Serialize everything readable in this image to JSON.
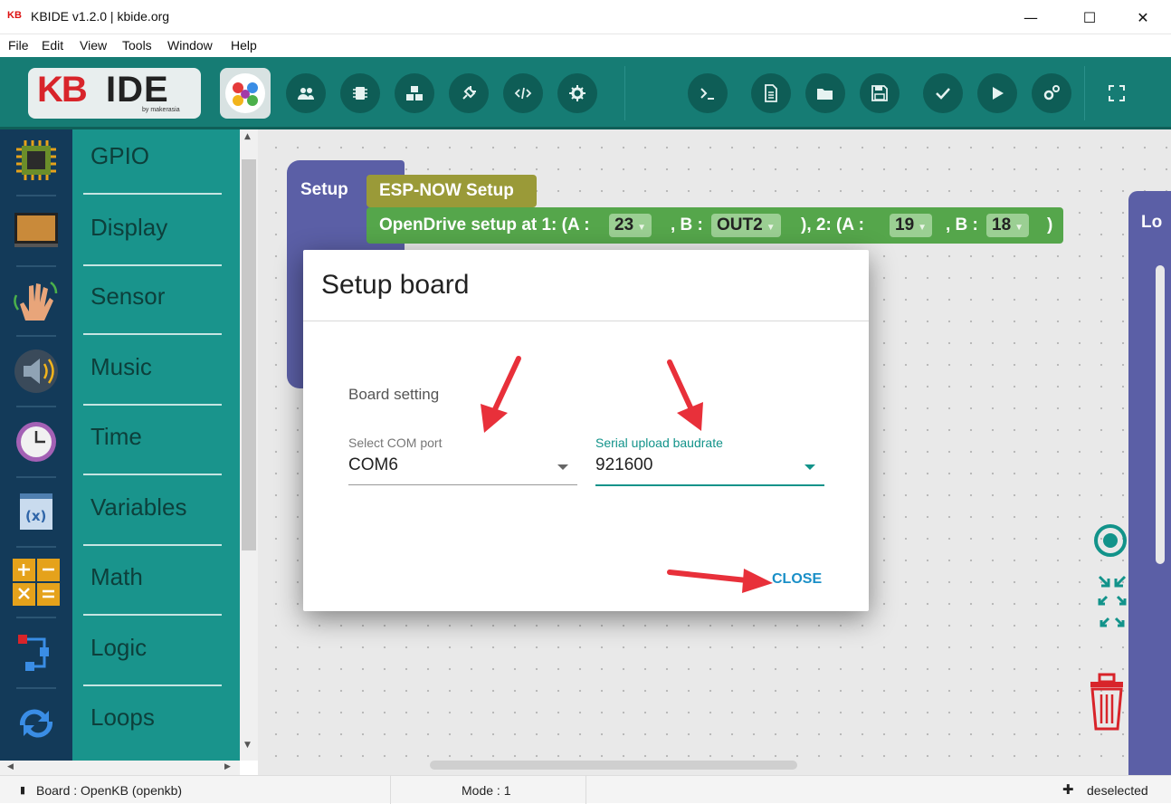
{
  "window": {
    "app_icon": "KB",
    "title": "KBIDE v1.2.0 | kbide.org",
    "minimize": "—",
    "maximize": "☐",
    "close": "✕"
  },
  "menu": [
    "File",
    "Edit",
    "View",
    "Tools",
    "Window",
    "Help"
  ],
  "toolbar": {
    "logo_kb": "KB",
    "logo_ide": "IDE",
    "logo_by": "by makerasia",
    "buttons": [
      "users-icon",
      "chip-icon",
      "cubes-icon",
      "plug-icon",
      "code-icon",
      "gear-icon",
      "terminal-icon",
      "new-file-icon",
      "open-folder-icon",
      "save-icon",
      "check-icon",
      "play-icon",
      "gears-icon",
      "fullscreen-icon"
    ]
  },
  "categories": [
    "GPIO",
    "Display",
    "Sensor",
    "Music",
    "Time",
    "Variables",
    "Math",
    "Logic",
    "Loops"
  ],
  "workspace": {
    "setup_label": "Setup",
    "esp_now_label": "ESP-NOW Setup",
    "opendrive": {
      "prefix": "OpenDrive setup at 1: (A :",
      "a1": "23",
      "b_label": ", B :",
      "b1": "OUT2",
      "mid": "), 2: (A :",
      "a2": "19",
      "b_label2": ", B :",
      "b2": "18",
      "suffix": ")"
    },
    "right_panel_label": "Lo"
  },
  "dialog": {
    "title": "Setup board",
    "section": "Board setting",
    "com_label": "Select COM port",
    "com_value": "COM6",
    "baud_label": "Serial upload baudrate",
    "baud_value": "921600",
    "close": "CLOSE"
  },
  "status": {
    "board": "Board : OpenKB (openkb)",
    "mode": "Mode : 1",
    "selection": "deselected"
  },
  "colors": {
    "toolbar": "#167c74",
    "category": "#19948c",
    "accent": "#12938a",
    "arrow": "#e8303a",
    "close": "#1a8fc7"
  }
}
